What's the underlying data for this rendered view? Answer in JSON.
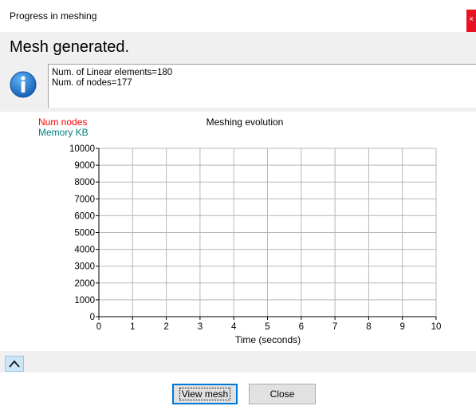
{
  "window": {
    "title": "Progress in meshing",
    "close_glyph": "×"
  },
  "status": {
    "heading": "Mesh generated.",
    "icon": "info-icon",
    "messages": [
      "Num. of Linear elements=180",
      "Num. of nodes=177"
    ]
  },
  "chart_data": {
    "type": "line",
    "title": "Meshing evolution",
    "xlabel": "Time (seconds)",
    "ylabel": "",
    "xlim": [
      0,
      10
    ],
    "ylim": [
      0,
      10000
    ],
    "x_ticks": [
      0,
      1,
      2,
      3,
      4,
      5,
      6,
      7,
      8,
      9,
      10
    ],
    "y_ticks": [
      0,
      1000,
      2000,
      3000,
      4000,
      5000,
      6000,
      7000,
      8000,
      9000,
      10000
    ],
    "grid": true,
    "legend_position": "top-left",
    "series": [
      {
        "name": "Num nodes",
        "color": "#ff0000",
        "values": []
      },
      {
        "name": "Memory KB",
        "color": "#008080",
        "values": []
      }
    ]
  },
  "buttons": {
    "view_mesh": "View mesh",
    "close": "Close"
  },
  "colors": {
    "accent": "#0078d7",
    "close_red": "#e81123",
    "panel": "#f0f0f0"
  }
}
